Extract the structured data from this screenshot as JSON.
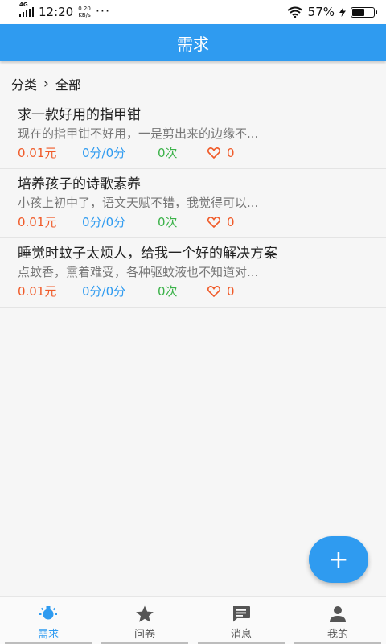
{
  "status_bar": {
    "network": "4G",
    "time": "12:20",
    "speed_value": "0.20",
    "speed_unit": "KB/s",
    "more": "···",
    "battery": "57%",
    "battery_level": 0.57
  },
  "app_bar": {
    "title": "需求"
  },
  "breadcrumb": {
    "root": "分类",
    "separator": "›",
    "current": "全部"
  },
  "items": [
    {
      "title": "求一款好用的指甲钳",
      "desc": "现在的指甲钳不好用，一是剪出来的边缘不...",
      "price": "0.01元",
      "score": "0分/0分",
      "count": "0次",
      "likes": "0"
    },
    {
      "title": "培养孩子的诗歌素养",
      "desc": "小孩上初中了，语文天赋不错，我觉得可以...",
      "price": "0.01元",
      "score": "0分/0分",
      "count": "0次",
      "likes": "0"
    },
    {
      "title": "睡觉时蚊子太烦人，给我一个好的解决方案",
      "desc": "点蚊香，熏着难受，各种驱蚊液也不知道对...",
      "price": "0.01元",
      "score": "0分/0分",
      "count": "0次",
      "likes": "0"
    }
  ],
  "fab": {
    "label": "+"
  },
  "bottom_nav": [
    {
      "label": "需求",
      "icon": "bulb-icon",
      "active": true
    },
    {
      "label": "问卷",
      "icon": "star-icon",
      "active": false
    },
    {
      "label": "消息",
      "icon": "chat-icon",
      "active": false
    },
    {
      "label": "我的",
      "icon": "person-icon",
      "active": false
    }
  ],
  "colors": {
    "primary": "#2f9bf0",
    "price": "#f05a28",
    "count": "#3cb24a"
  }
}
